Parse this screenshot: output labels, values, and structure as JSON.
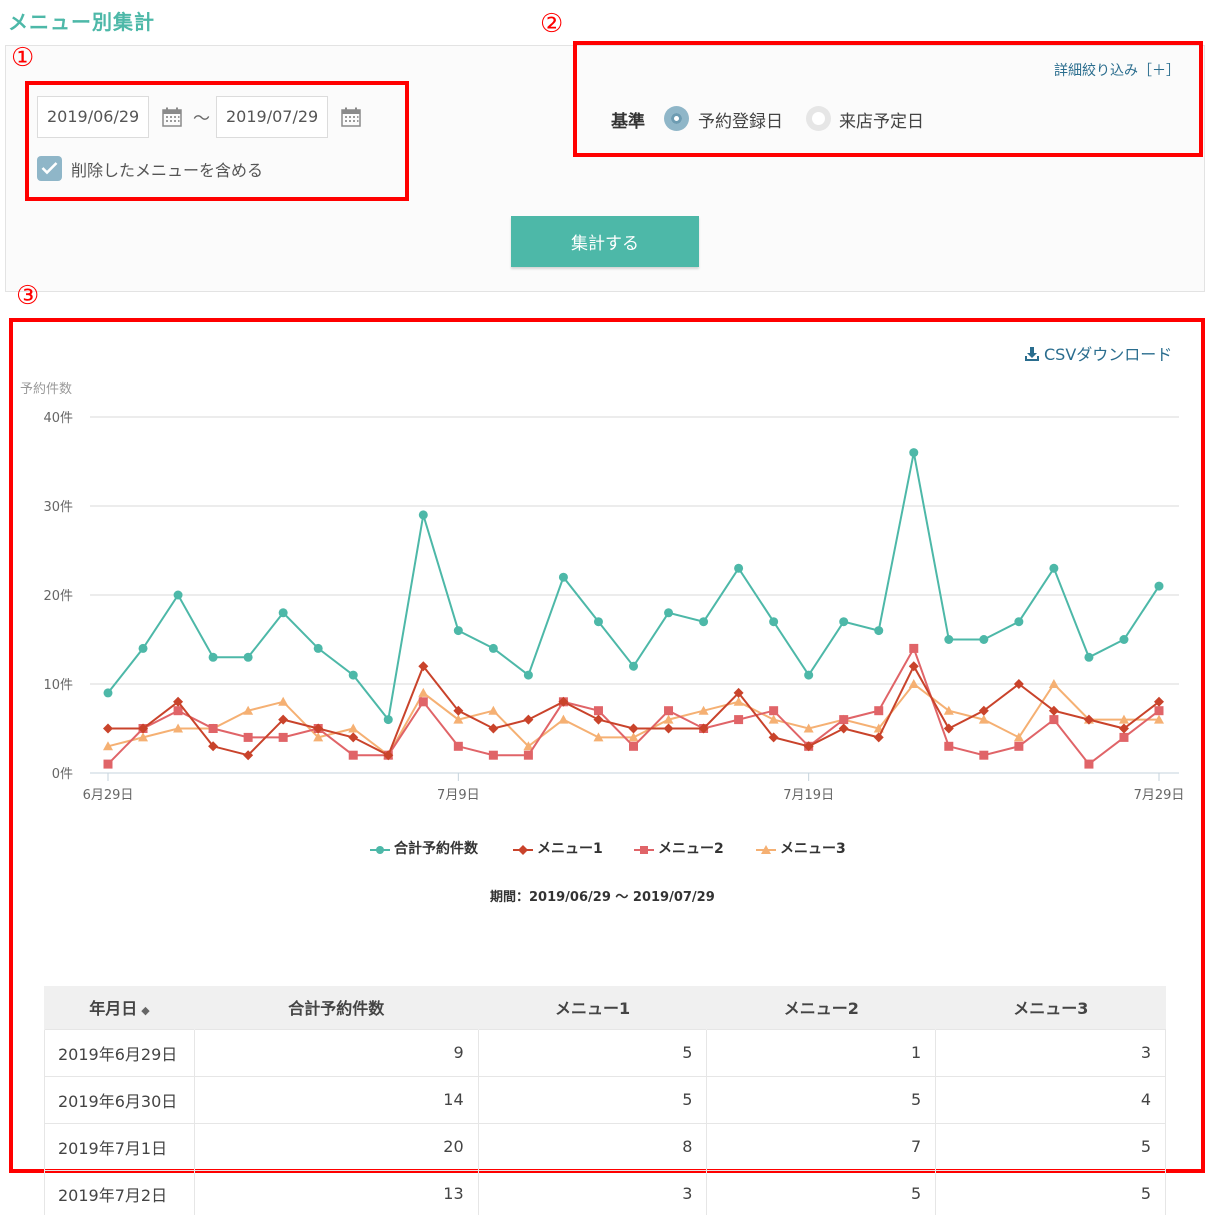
{
  "page_title": "メニュー別集計",
  "filters": {
    "start_date": "2019/06/29",
    "end_date": "2019/07/29",
    "range_separator": "～",
    "include_deleted_label": "削除したメニューを含める",
    "include_deleted_checked": true,
    "detail_filter_link": "詳細絞り込み［＋］",
    "basis_label": "基準",
    "basis_options": [
      "予約登録日",
      "来店予定日"
    ],
    "basis_selected": "予約登録日",
    "submit_label": "集計する"
  },
  "annotations": [
    "①",
    "②",
    "③"
  ],
  "csv_download_label": "CSVダウンロード",
  "period_label": "期間：2019/06/29 ～ 2019/07/29",
  "colors": {
    "accent": "#4db8a8",
    "link": "#2a6d8e",
    "highlight": "#ff0000",
    "series_total": "#4db8a8",
    "series_menu1": "#c9432b",
    "series_menu2": "#e06468",
    "series_menu3": "#f5b073"
  },
  "chart_data": {
    "type": "line",
    "ylabel": "予約件数",
    "ylim": [
      0,
      40
    ],
    "y_ticks": [
      0,
      10,
      20,
      30,
      40
    ],
    "y_tick_suffix": "件",
    "x_tick_labels": [
      "6月29日",
      "7月9日",
      "7月19日",
      "7月29日"
    ],
    "x_tick_indices": [
      0,
      10,
      20,
      30
    ],
    "x": [
      "6/29",
      "6/30",
      "7/1",
      "7/2",
      "7/3",
      "7/4",
      "7/5",
      "7/6",
      "7/7",
      "7/8",
      "7/9",
      "7/10",
      "7/11",
      "7/12",
      "7/13",
      "7/14",
      "7/15",
      "7/16",
      "7/17",
      "7/18",
      "7/19",
      "7/20",
      "7/21",
      "7/22",
      "7/23",
      "7/24",
      "7/25",
      "7/26",
      "7/27",
      "7/28",
      "7/29"
    ],
    "legend_position": "bottom",
    "grid": true,
    "series": [
      {
        "name": "合計予約件数",
        "marker": "circle",
        "color": "#4db8a8",
        "values": [
          9,
          14,
          20,
          13,
          13,
          18,
          14,
          11,
          6,
          29,
          16,
          14,
          11,
          22,
          17,
          12,
          18,
          17,
          23,
          17,
          11,
          17,
          16,
          36,
          15,
          15,
          17,
          23,
          13,
          15,
          21
        ]
      },
      {
        "name": "メニュー1",
        "marker": "diamond",
        "color": "#c9432b",
        "values": [
          5,
          5,
          8,
          3,
          2,
          6,
          5,
          4,
          2,
          12,
          7,
          5,
          6,
          8,
          6,
          5,
          5,
          5,
          9,
          4,
          3,
          5,
          4,
          12,
          5,
          7,
          10,
          7,
          6,
          5,
          8
        ]
      },
      {
        "name": "メニュー2",
        "marker": "square",
        "color": "#e06468",
        "values": [
          1,
          5,
          7,
          5,
          4,
          4,
          5,
          2,
          2,
          8,
          3,
          2,
          2,
          8,
          7,
          3,
          7,
          5,
          6,
          7,
          3,
          6,
          7,
          14,
          3,
          2,
          3,
          6,
          1,
          4,
          7
        ]
      },
      {
        "name": "メニュー3",
        "marker": "triangle",
        "color": "#f5b073",
        "values": [
          3,
          4,
          5,
          5,
          7,
          8,
          4,
          5,
          2,
          9,
          6,
          7,
          3,
          6,
          4,
          4,
          6,
          7,
          8,
          6,
          5,
          6,
          5,
          10,
          7,
          6,
          4,
          10,
          6,
          6,
          6
        ]
      }
    ]
  },
  "table": {
    "headers": [
      "年月日",
      "合計予約件数",
      "メニュー1",
      "メニュー2",
      "メニュー3"
    ],
    "sort_icon": "sort-icon",
    "rows": [
      [
        "2019年6月29日",
        "9",
        "5",
        "1",
        "3"
      ],
      [
        "2019年6月30日",
        "14",
        "5",
        "5",
        "4"
      ],
      [
        "2019年7月1日",
        "20",
        "8",
        "7",
        "5"
      ],
      [
        "2019年7月2日",
        "13",
        "3",
        "5",
        "5"
      ]
    ]
  }
}
